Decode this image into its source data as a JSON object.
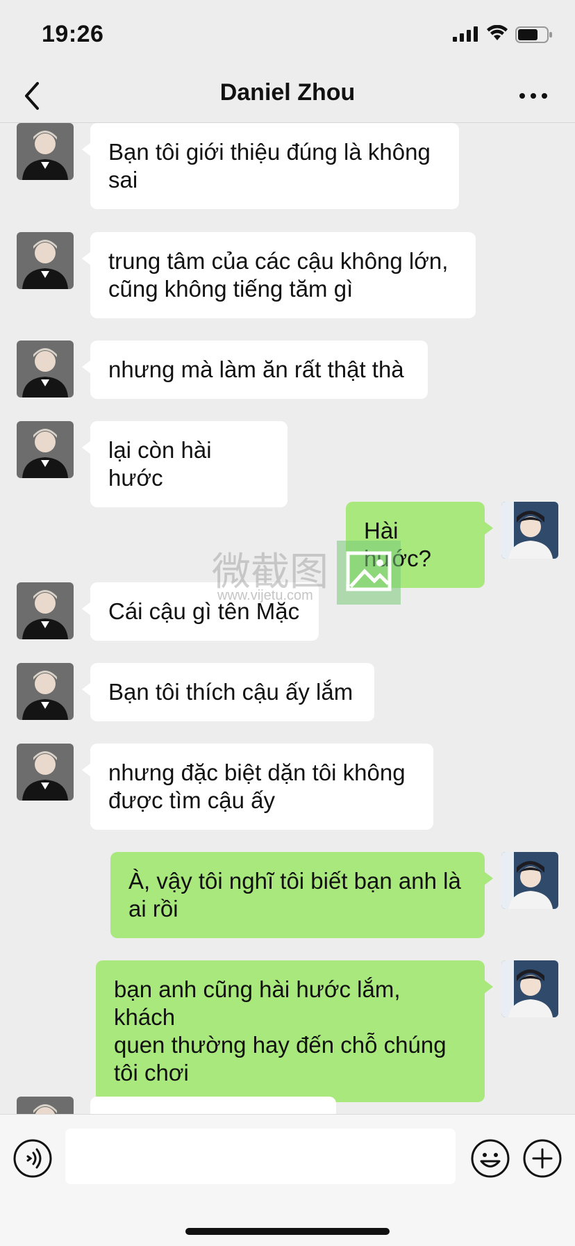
{
  "status_bar": {
    "time": "19:26"
  },
  "nav": {
    "title": "Daniel Zhou",
    "back_icon": "chevron-left-icon",
    "more_icon": "more-icon"
  },
  "watermark": {
    "text": "微截图",
    "url": "www.vijetu.com"
  },
  "messages": [
    {
      "side": "in",
      "lines": [
        "Bạn tôi giới thiệu đúng là không",
        "sai"
      ]
    },
    {
      "side": "in",
      "lines": [
        "trung tâm của các cậu không lớn,",
        "cũng không tiếng tăm gì"
      ]
    },
    {
      "side": "in",
      "lines": [
        "nhưng mà làm ăn rất thật thà"
      ]
    },
    {
      "side": "in",
      "lines": [
        "lại còn hài hước"
      ]
    },
    {
      "side": "out",
      "lines": [
        "Hài hước?"
      ]
    },
    {
      "side": "in",
      "lines": [
        "Cái cậu gì tên Mặc"
      ]
    },
    {
      "side": "in",
      "lines": [
        "Bạn tôi thích cậu ấy lắm"
      ]
    },
    {
      "side": "in",
      "lines": [
        "nhưng đặc biệt dặn tôi không",
        "được tìm cậu ấy"
      ]
    },
    {
      "side": "out",
      "lines": [
        "À, vậy tôi nghĩ tôi biết bạn anh là",
        "ai rồi"
      ]
    },
    {
      "side": "out",
      "lines": [
        "bạn anh cũng hài hước lắm, khách",
        "quen thường hay đến chỗ chúng",
        "tôi chơi"
      ]
    },
    {
      "side": "in",
      "lines": [
        ""
      ]
    }
  ],
  "input": {
    "placeholder": "",
    "voice_icon": "voice-icon",
    "emoji_icon": "emoji-icon",
    "plus_icon": "plus-icon"
  }
}
